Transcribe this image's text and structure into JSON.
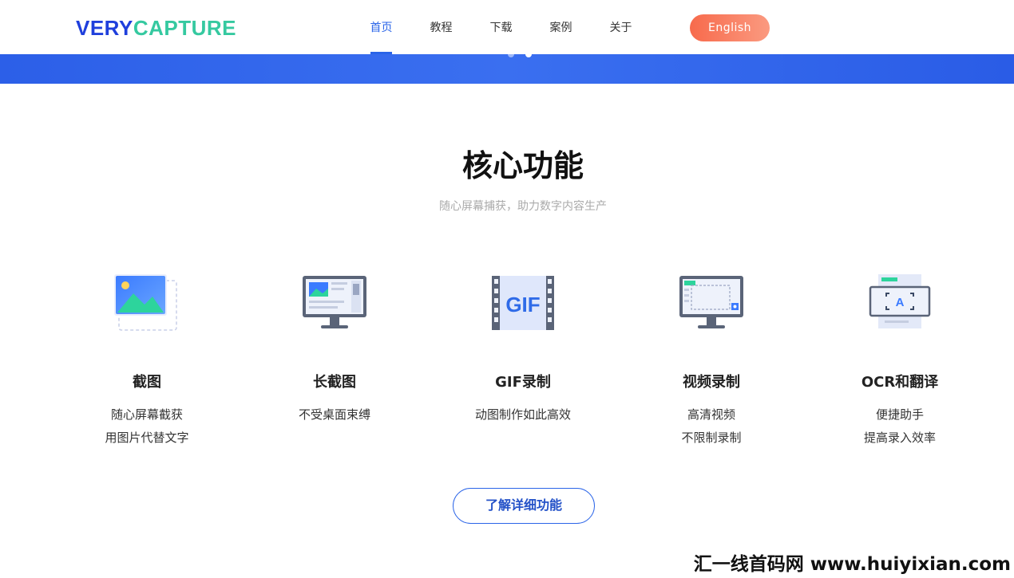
{
  "header": {
    "logo_part1": "VERY",
    "logo_part2": "CAPTURE",
    "nav": [
      "首页",
      "教程",
      "下载",
      "案例",
      "关于"
    ],
    "active_nav": "首页",
    "lang_button": "English"
  },
  "section": {
    "title": "核心功能",
    "subtitle": "随心屏幕捕获，助力数字内容生产"
  },
  "features": [
    {
      "icon": "screenshot-image-icon",
      "title": "截图",
      "desc1": "随心屏幕截获",
      "desc2": "用图片代替文字"
    },
    {
      "icon": "long-screenshot-monitor-icon",
      "title": "长截图",
      "desc1": "不受桌面束缚",
      "desc2": ""
    },
    {
      "icon": "gif-film-icon",
      "title": "GIF录制",
      "desc1": "动图制作如此高效",
      "desc2": ""
    },
    {
      "icon": "video-record-monitor-icon",
      "title": "视频录制",
      "desc1": "高清视频",
      "desc2": "不限制录制"
    },
    {
      "icon": "ocr-translate-icon",
      "title": "OCR和翻译",
      "desc1": "便捷助手",
      "desc2": "提高录入效率"
    }
  ],
  "more_button": "了解详细功能",
  "watermark": "汇一线首码网 www.huiyixian.com",
  "colors": {
    "brand_blue": "#1f3fdc",
    "brand_green": "#35c9a0",
    "accent_blue": "#2a64e8",
    "lang_button": "#f76a4c"
  }
}
